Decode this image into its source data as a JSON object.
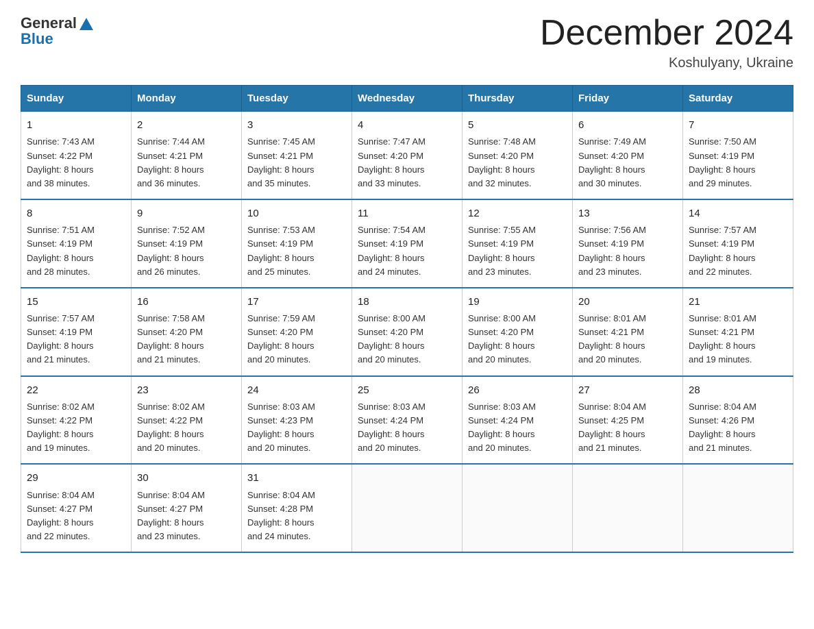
{
  "logo": {
    "general": "General",
    "blue": "Blue"
  },
  "title": "December 2024",
  "location": "Koshulyany, Ukraine",
  "days_header": [
    "Sunday",
    "Monday",
    "Tuesday",
    "Wednesday",
    "Thursday",
    "Friday",
    "Saturday"
  ],
  "weeks": [
    [
      {
        "day": "1",
        "info": "Sunrise: 7:43 AM\nSunset: 4:22 PM\nDaylight: 8 hours\nand 38 minutes."
      },
      {
        "day": "2",
        "info": "Sunrise: 7:44 AM\nSunset: 4:21 PM\nDaylight: 8 hours\nand 36 minutes."
      },
      {
        "day": "3",
        "info": "Sunrise: 7:45 AM\nSunset: 4:21 PM\nDaylight: 8 hours\nand 35 minutes."
      },
      {
        "day": "4",
        "info": "Sunrise: 7:47 AM\nSunset: 4:20 PM\nDaylight: 8 hours\nand 33 minutes."
      },
      {
        "day": "5",
        "info": "Sunrise: 7:48 AM\nSunset: 4:20 PM\nDaylight: 8 hours\nand 32 minutes."
      },
      {
        "day": "6",
        "info": "Sunrise: 7:49 AM\nSunset: 4:20 PM\nDaylight: 8 hours\nand 30 minutes."
      },
      {
        "day": "7",
        "info": "Sunrise: 7:50 AM\nSunset: 4:19 PM\nDaylight: 8 hours\nand 29 minutes."
      }
    ],
    [
      {
        "day": "8",
        "info": "Sunrise: 7:51 AM\nSunset: 4:19 PM\nDaylight: 8 hours\nand 28 minutes."
      },
      {
        "day": "9",
        "info": "Sunrise: 7:52 AM\nSunset: 4:19 PM\nDaylight: 8 hours\nand 26 minutes."
      },
      {
        "day": "10",
        "info": "Sunrise: 7:53 AM\nSunset: 4:19 PM\nDaylight: 8 hours\nand 25 minutes."
      },
      {
        "day": "11",
        "info": "Sunrise: 7:54 AM\nSunset: 4:19 PM\nDaylight: 8 hours\nand 24 minutes."
      },
      {
        "day": "12",
        "info": "Sunrise: 7:55 AM\nSunset: 4:19 PM\nDaylight: 8 hours\nand 23 minutes."
      },
      {
        "day": "13",
        "info": "Sunrise: 7:56 AM\nSunset: 4:19 PM\nDaylight: 8 hours\nand 23 minutes."
      },
      {
        "day": "14",
        "info": "Sunrise: 7:57 AM\nSunset: 4:19 PM\nDaylight: 8 hours\nand 22 minutes."
      }
    ],
    [
      {
        "day": "15",
        "info": "Sunrise: 7:57 AM\nSunset: 4:19 PM\nDaylight: 8 hours\nand 21 minutes."
      },
      {
        "day": "16",
        "info": "Sunrise: 7:58 AM\nSunset: 4:20 PM\nDaylight: 8 hours\nand 21 minutes."
      },
      {
        "day": "17",
        "info": "Sunrise: 7:59 AM\nSunset: 4:20 PM\nDaylight: 8 hours\nand 20 minutes."
      },
      {
        "day": "18",
        "info": "Sunrise: 8:00 AM\nSunset: 4:20 PM\nDaylight: 8 hours\nand 20 minutes."
      },
      {
        "day": "19",
        "info": "Sunrise: 8:00 AM\nSunset: 4:20 PM\nDaylight: 8 hours\nand 20 minutes."
      },
      {
        "day": "20",
        "info": "Sunrise: 8:01 AM\nSunset: 4:21 PM\nDaylight: 8 hours\nand 20 minutes."
      },
      {
        "day": "21",
        "info": "Sunrise: 8:01 AM\nSunset: 4:21 PM\nDaylight: 8 hours\nand 19 minutes."
      }
    ],
    [
      {
        "day": "22",
        "info": "Sunrise: 8:02 AM\nSunset: 4:22 PM\nDaylight: 8 hours\nand 19 minutes."
      },
      {
        "day": "23",
        "info": "Sunrise: 8:02 AM\nSunset: 4:22 PM\nDaylight: 8 hours\nand 20 minutes."
      },
      {
        "day": "24",
        "info": "Sunrise: 8:03 AM\nSunset: 4:23 PM\nDaylight: 8 hours\nand 20 minutes."
      },
      {
        "day": "25",
        "info": "Sunrise: 8:03 AM\nSunset: 4:24 PM\nDaylight: 8 hours\nand 20 minutes."
      },
      {
        "day": "26",
        "info": "Sunrise: 8:03 AM\nSunset: 4:24 PM\nDaylight: 8 hours\nand 20 minutes."
      },
      {
        "day": "27",
        "info": "Sunrise: 8:04 AM\nSunset: 4:25 PM\nDaylight: 8 hours\nand 21 minutes."
      },
      {
        "day": "28",
        "info": "Sunrise: 8:04 AM\nSunset: 4:26 PM\nDaylight: 8 hours\nand 21 minutes."
      }
    ],
    [
      {
        "day": "29",
        "info": "Sunrise: 8:04 AM\nSunset: 4:27 PM\nDaylight: 8 hours\nand 22 minutes."
      },
      {
        "day": "30",
        "info": "Sunrise: 8:04 AM\nSunset: 4:27 PM\nDaylight: 8 hours\nand 23 minutes."
      },
      {
        "day": "31",
        "info": "Sunrise: 8:04 AM\nSunset: 4:28 PM\nDaylight: 8 hours\nand 24 minutes."
      },
      {
        "day": "",
        "info": ""
      },
      {
        "day": "",
        "info": ""
      },
      {
        "day": "",
        "info": ""
      },
      {
        "day": "",
        "info": ""
      }
    ]
  ]
}
